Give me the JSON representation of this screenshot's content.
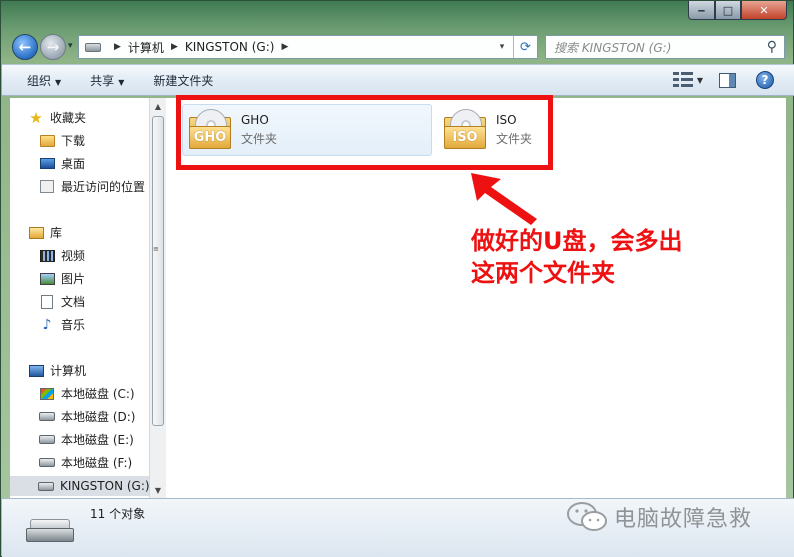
{
  "window": {
    "controls": {
      "minimize": "‒",
      "maximize": "□",
      "close": "✕"
    }
  },
  "address": {
    "crumbs": [
      "计算机",
      "KINGSTON (G:)"
    ],
    "search_placeholder": "搜索 KINGSTON (G:)"
  },
  "toolbar": {
    "organize": "组织",
    "share": "共享",
    "new_folder": "新建文件夹"
  },
  "sidebar": {
    "favorites": {
      "label": "收藏夹",
      "items": [
        "下载",
        "桌面",
        "最近访问的位置"
      ]
    },
    "libraries": {
      "label": "库",
      "items": [
        "视频",
        "图片",
        "文档",
        "音乐"
      ]
    },
    "computer": {
      "label": "计算机",
      "drives": [
        "本地磁盘 (C:)",
        "本地磁盘 (D:)",
        "本地磁盘 (E:)",
        "本地磁盘 (F:)",
        "KINGSTON (G:)"
      ]
    }
  },
  "files": [
    {
      "name": "GHO",
      "type": "文件夹",
      "badge": "GHO",
      "selected": true
    },
    {
      "name": "ISO",
      "type": "文件夹",
      "badge": "ISO",
      "selected": false
    }
  ],
  "annotation": {
    "line1": "做好的U盘，会多出",
    "line2": "这两个文件夹",
    "color": "#ee1111"
  },
  "details": {
    "count": "11 个对象"
  },
  "watermark": {
    "text": "电脑故障急救"
  }
}
